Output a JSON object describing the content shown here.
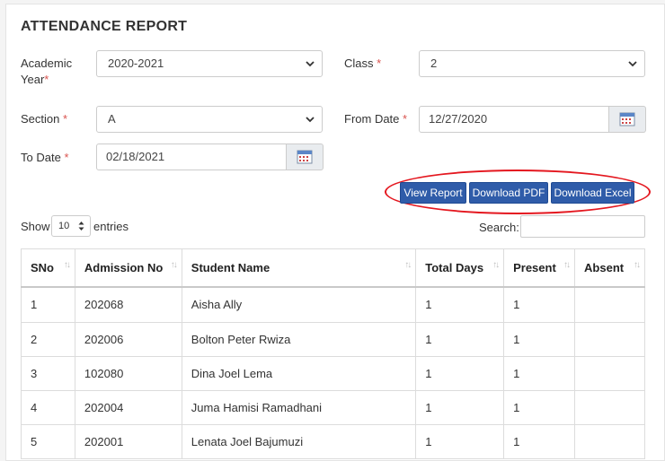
{
  "page_title": "ATTENDANCE REPORT",
  "form": {
    "academic_year": {
      "label_line1": "Academic",
      "label_line2": "Year",
      "required": "*",
      "value": "2020-2021"
    },
    "class": {
      "label": "Class",
      "required": "*",
      "value": "2"
    },
    "section": {
      "label": "Section",
      "required": "*",
      "value": "A"
    },
    "from_date": {
      "label": "From Date",
      "required": "*",
      "value": "12/27/2020"
    },
    "to_date": {
      "label": "To Date",
      "required": "*",
      "value": "02/18/2021"
    }
  },
  "actions": {
    "view_report": "View Report",
    "download_pdf": "Download PDF",
    "download_excel": "Download Excel"
  },
  "length_menu": {
    "show": "Show",
    "value": "10",
    "entries": "entries"
  },
  "search": {
    "label": "Search:",
    "value": ""
  },
  "table": {
    "headers": [
      "SNo",
      "Admission No",
      "Student Name",
      "Total Days",
      "Present",
      "Absent"
    ],
    "rows": [
      [
        "1",
        "202068",
        "Aisha Ally",
        "1",
        "1",
        ""
      ],
      [
        "2",
        "202006",
        "Bolton Peter Rwiza",
        "1",
        "1",
        ""
      ],
      [
        "3",
        "102080",
        "Dina Joel Lema",
        "1",
        "1",
        ""
      ],
      [
        "4",
        "202004",
        "Juma Hamisi Ramadhani",
        "1",
        "1",
        ""
      ],
      [
        "5",
        "202001",
        "Lenata Joel Bajumuzi",
        "1",
        "1",
        ""
      ]
    ]
  },
  "colors": {
    "button": "#2f5ca9",
    "required": "#d9534f",
    "highlight_ring": "#e4171f"
  }
}
